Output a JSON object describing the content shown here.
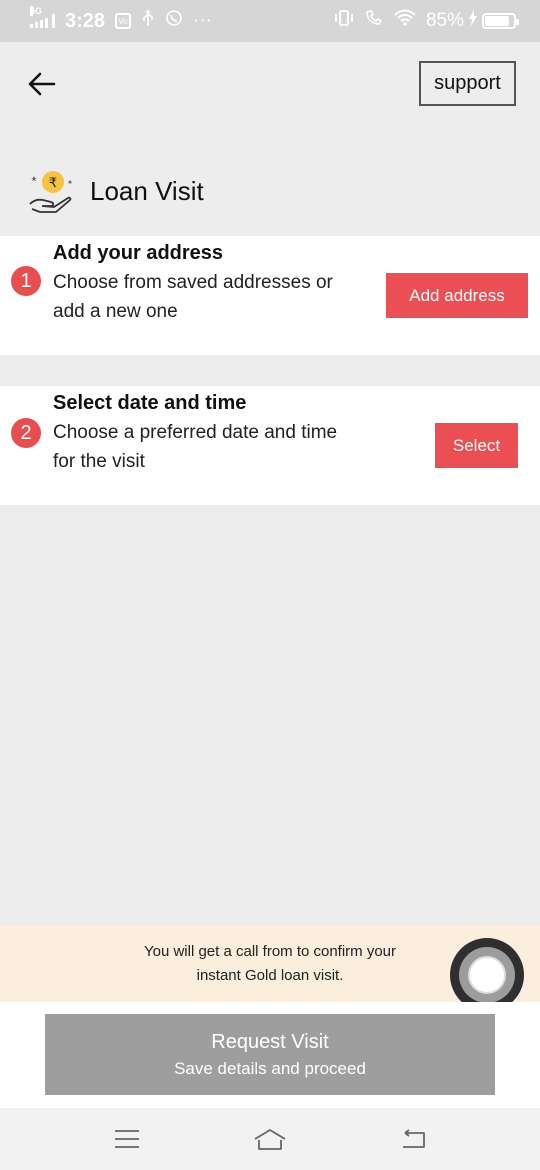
{
  "status_bar": {
    "network": "4G",
    "time": "3:28",
    "more": "···",
    "battery_percent": "85%",
    "battery_level": 0.85,
    "icons": [
      "volte-icon",
      "usb-icon",
      "whatsapp-icon",
      "vibrate-icon",
      "wifi-call-icon",
      "wifi-icon",
      "charging-icon",
      "battery-icon"
    ]
  },
  "header": {
    "back_icon": "arrow-left-icon",
    "support_label": "support",
    "title": "Loan Visit",
    "title_icon": "rupee-coin-hand-icon"
  },
  "steps": [
    {
      "number": "1",
      "title": "Add your address",
      "description": "Choose from saved addresses or add a new one",
      "button_label": "Add address"
    },
    {
      "number": "2",
      "title": "Select date and time",
      "description": "Choose a preferred date and time for the visit",
      "button_label": "Select"
    }
  ],
  "banner": {
    "text": "You will get a call from to confirm your instant Gold loan visit."
  },
  "request": {
    "title": "Request Visit",
    "subtitle": "Save details and proceed"
  },
  "colors": {
    "accent": "#ec4f53",
    "disabled_button": "#9e9e9e",
    "banner_bg": "#fbeedc",
    "page_bg": "#ededed"
  },
  "nav_bar": {
    "icons": [
      "menu-icon",
      "home-icon",
      "back-icon"
    ]
  }
}
